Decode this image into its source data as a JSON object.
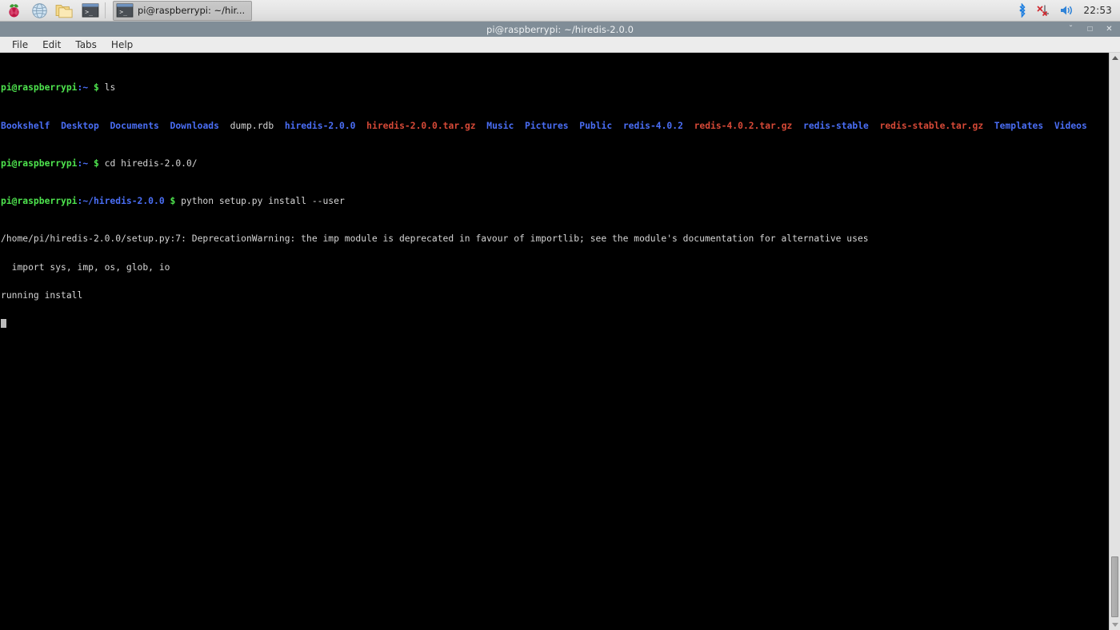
{
  "taskbar": {
    "launchers": [
      {
        "name": "raspberry-menu-icon",
        "label": "Raspberry Pi Menu"
      },
      {
        "name": "web-browser-icon",
        "label": "Web Browser"
      },
      {
        "name": "file-manager-icon",
        "label": "File Manager"
      },
      {
        "name": "terminal-launcher-icon",
        "label": "Terminal"
      }
    ],
    "window_button": {
      "label": "pi@raspberrypi: ~/hir...",
      "icon": "terminal-icon"
    },
    "tray": {
      "bluetooth_icon": "bluetooth-icon",
      "network_icon": "network-disconnected-icon",
      "volume_icon": "volume-icon",
      "clock": "22:53"
    }
  },
  "window": {
    "title": "pi@raspberrypi: ~/hiredis-2.0.0",
    "controls": {
      "minimize": "ˇ",
      "maximize": "□",
      "close": "✕"
    },
    "menu": [
      "File",
      "Edit",
      "Tabs",
      "Help"
    ]
  },
  "terminal": {
    "prompt1": {
      "user": "pi@raspberrypi",
      "path": ":~",
      "dollar": "$",
      "command": "ls"
    },
    "ls_output": [
      {
        "text": "Bookshelf",
        "type": "dir"
      },
      {
        "text": "Desktop",
        "type": "dir"
      },
      {
        "text": "Documents",
        "type": "dir"
      },
      {
        "text": "Downloads",
        "type": "dir"
      },
      {
        "text": "dump.rdb",
        "type": "file"
      },
      {
        "text": "hiredis-2.0.0",
        "type": "dir"
      },
      {
        "text": "hiredis-2.0.0.tar.gz",
        "type": "archive"
      },
      {
        "text": "Music",
        "type": "dir"
      },
      {
        "text": "Pictures",
        "type": "dir"
      },
      {
        "text": "Public",
        "type": "dir"
      },
      {
        "text": "redis-4.0.2",
        "type": "dir"
      },
      {
        "text": "redis-4.0.2.tar.gz",
        "type": "archive"
      },
      {
        "text": "redis-stable",
        "type": "dir"
      },
      {
        "text": "redis-stable.tar.gz",
        "type": "archive"
      },
      {
        "text": "Templates",
        "type": "dir"
      },
      {
        "text": "Videos",
        "type": "dir"
      }
    ],
    "prompt2": {
      "user": "pi@raspberrypi",
      "path": ":~",
      "dollar": "$",
      "command": "cd hiredis-2.0.0/"
    },
    "prompt3": {
      "user": "pi@raspberrypi",
      "path": ":~/hiredis-2.0.0",
      "dollar": "$",
      "command": "python setup.py install --user"
    },
    "output_lines": [
      "/home/pi/hiredis-2.0.0/setup.py:7: DeprecationWarning: the imp module is deprecated in favour of importlib; see the module's documentation for alternative uses",
      "  import sys, imp, os, glob, io",
      "running install"
    ]
  },
  "colors": {
    "titlebar": "#808d97",
    "menubar": "#ececec",
    "terminal_bg": "#000000",
    "prompt_green": "#4ee44e",
    "dir_blue": "#4a6ef5",
    "archive_red": "#d64937",
    "text_gray": "#d6d6d6"
  }
}
